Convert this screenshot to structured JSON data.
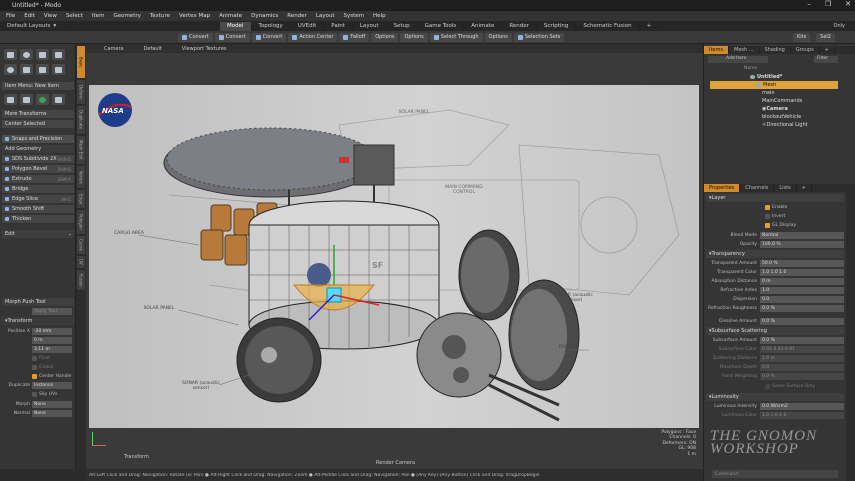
{
  "window": {
    "title": "Untitled* - Modo",
    "min": "–",
    "max": "❐",
    "close": "✕"
  },
  "menu": [
    "File",
    "Edit",
    "View",
    "Select",
    "Item",
    "Geometry",
    "Texture",
    "Vertex Map",
    "Animate",
    "Dynamics",
    "Render",
    "Layout",
    "System",
    "Help"
  ],
  "layout_selector": "Default Layouts",
  "tabs": [
    {
      "label": "Model",
      "active": true
    },
    {
      "label": "Topology"
    },
    {
      "label": "UVEdit"
    },
    {
      "label": "Paint"
    },
    {
      "label": "Layout"
    },
    {
      "label": "Setup"
    },
    {
      "label": "Game Tools"
    },
    {
      "label": "Animate"
    },
    {
      "label": "Render"
    },
    {
      "label": "Scripting"
    },
    {
      "label": "Schematic Fusion"
    },
    {
      "label": "+"
    }
  ],
  "tab_right": {
    "only": "Only"
  },
  "toolbar": [
    "Convert",
    "Convert",
    "Convert",
    "Action Center",
    "Falloff",
    "Options",
    "Options",
    "Select Through",
    "Options",
    "Selection Sets"
  ],
  "toolbar_right": [
    "Kits",
    "Sel2"
  ],
  "left": {
    "item_menu": "Item Menu: New Item",
    "more_transforms": "More Transforms",
    "center_selected": "Center Selected",
    "snaps": "Snaps and Precision",
    "add_geometry": "Add Geometry",
    "tools": [
      {
        "label": "SDS Subdivide 2X",
        "shortcut": "Shift-D"
      },
      {
        "label": "Polygon Bevel",
        "shortcut": "Shift-B"
      },
      {
        "label": "Extrude",
        "shortcut": "Shift-X"
      },
      {
        "label": "Bridge",
        "shortcut": ""
      },
      {
        "label": "Edge Slice",
        "shortcut": "Alt-C"
      },
      {
        "label": "Smooth Shift",
        "shortcut": ""
      },
      {
        "label": "Thicken",
        "shortcut": ""
      }
    ],
    "edit": "Edit",
    "vtabs": [
      "Basic",
      "Deform",
      "Duplicate",
      "Mesh Edit",
      "Vertex",
      "Edge",
      "Polygon",
      "Curve",
      "UV",
      "Fusion"
    ],
    "tool_props": {
      "title": "Morph Push Tool",
      "apply": "Apply Tool",
      "transform": "Transform",
      "position_label": "Position X",
      "pos_x": "-20 mm",
      "pos_y": "0 m",
      "pos_z": "3.11 m",
      "pivot": "Pivot",
      "global": "Global",
      "center_handle": "Center Handle",
      "duplicate_label": "Duplicate",
      "duplicate_val": "Instance",
      "slip_uvs": "Slip UVs",
      "morph_label": "Morph",
      "morph_val": "None",
      "normal_label": "Normal",
      "normal_val": "None"
    }
  },
  "viewport": {
    "header": [
      "Camera",
      "Default",
      "Viewport Textures"
    ],
    "labels": {
      "nasa": "NASA",
      "cargo": "CARGO AREA",
      "solar": "SOLAR PANEL",
      "sonar": "SONAR (acoustic sensor)",
      "radome": "RADOME",
      "sonar2": "SONAR (acoustic sensor)",
      "solar_top": "SOLAR PANEL",
      "main_cmd": "MAIN COMMAND CONTROL",
      "sf": "SF"
    },
    "transform_label": "Transform",
    "render_camera": "Render Camera",
    "stats": [
      "All Polygons",
      "Polygons : Face",
      "Channels: 0",
      "Deformers: ON",
      "GL: 908",
      "1 m"
    ]
  },
  "status": "Alt-Left Click and Drag: Navigation: Rotate (or Pan) ● Alt-Right Click and Drag: Navigation: Zoom ● Alt-Middle Click and Drag: Navigation: Pan ● [Any Key]-[Any Button] Click and Drag: dragDropBegin",
  "right": {
    "tabs": [
      "Items",
      "Mesh ...",
      "Shading",
      "Groups",
      "+"
    ],
    "add_item": "Add Item",
    "filter": "Filter",
    "col_name": "Name",
    "items": [
      {
        "label": "Untitled*",
        "sel": false,
        "indent": 1
      },
      {
        "label": "Mesh",
        "sel": true,
        "indent": 2
      },
      {
        "label": "main",
        "sel": false,
        "indent": 3
      },
      {
        "label": "MainCommands",
        "sel": false,
        "indent": 3
      },
      {
        "label": "Camera",
        "sel": false,
        "indent": 3
      },
      {
        "label": "blockoutVehicle",
        "sel": false,
        "indent": 3
      },
      {
        "label": "Directional Light",
        "sel": false,
        "indent": 3
      }
    ],
    "prop_tabs": [
      "Properties",
      "Channels",
      "Lists",
      "+"
    ],
    "layer": "Layer",
    "enable": "Enable",
    "invert": "Invert",
    "gl_display": "GL Display",
    "blend_mode_label": "Blend Mode",
    "blend_mode": "Normal",
    "opacity_label": "Opacity",
    "opacity": "100.0 %",
    "transparency": "Transparency",
    "props": [
      {
        "label": "Transparent Amount",
        "value": "50.0 %"
      },
      {
        "label": "Transparent Color",
        "value": "1.0      1.0      1.0"
      },
      {
        "label": "Absorption Distance",
        "value": "0 m"
      },
      {
        "label": "Refractive Index",
        "value": "1.0"
      },
      {
        "label": "Dispersion",
        "value": "0.0"
      },
      {
        "label": "Refraction Roughness",
        "value": "0.0 %"
      },
      {
        "label": "Dissolve Amount",
        "value": "0.0 %"
      }
    ],
    "subsurface": "Subsurface Scattering",
    "subsurface_props": [
      {
        "label": "Subsurface Amount",
        "value": "0.0 %"
      },
      {
        "label": "Subsurface Color",
        "value": "0.91   0.91   0.91"
      },
      {
        "label": "Scattering Distance",
        "value": "1.0 m"
      },
      {
        "label": "Maximum Depth",
        "value": "0.0"
      },
      {
        "label": "Front Weighting",
        "value": "0.0 %"
      }
    ],
    "same_surface": "Same Surface Only",
    "luminosity": "Luminosity",
    "luminous_intensity_label": "Luminous Intensity",
    "luminous_intensity": "0.0 W/srm2",
    "luminous_color_label": "Luminous Color",
    "luminous_color": "1.0      1.0      1.0",
    "command": "Command"
  },
  "watermark": {
    "line1": "THE GNOMON",
    "line2": "WORKSHOP"
  },
  "colors": {
    "accent": "#d08a2a",
    "selection": "#e0a23a"
  }
}
